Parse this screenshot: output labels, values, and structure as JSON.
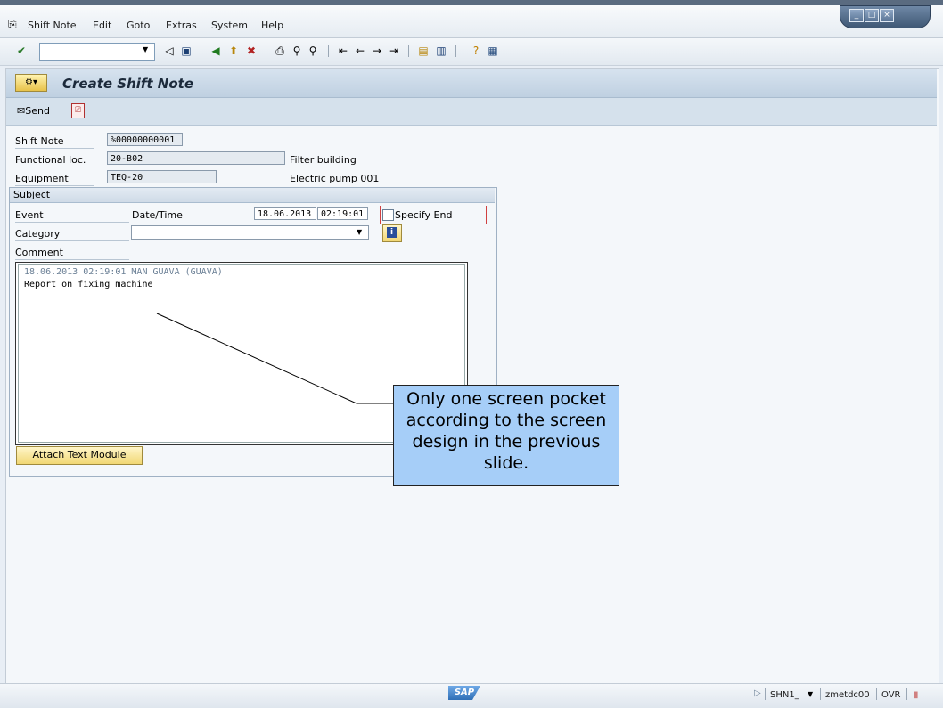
{
  "menu": {
    "items": [
      {
        "label": "Shift Note"
      },
      {
        "label": "Edit"
      },
      {
        "label": "Goto"
      },
      {
        "label": "Extras"
      },
      {
        "label": "System"
      },
      {
        "label": "Help"
      }
    ]
  },
  "window_controls": {
    "minimize": "_",
    "maximize": "□",
    "close": "×"
  },
  "toolbar": {
    "command_field_value": "",
    "icons": [
      "enter-icon",
      "back-arrow-icon",
      "save-icon",
      "back-icon",
      "exit-icon",
      "cancel-icon",
      "print-icon",
      "find-icon",
      "find-next-icon",
      "first-page-icon",
      "prev-page-icon",
      "next-page-icon",
      "last-page-icon",
      "new-session-icon",
      "shortcut-icon",
      "help-icon",
      "layout-icon"
    ]
  },
  "title": "Create Shift Note",
  "appbar": {
    "send_label": "Send"
  },
  "form": {
    "shift_note_label": "Shift Note",
    "shift_note_value": "%00000000001",
    "functional_loc_label": "Functional loc.",
    "functional_loc_value": "20-B02",
    "functional_loc_desc": "Filter building",
    "equipment_label": "Equipment",
    "equipment_value": "TEQ-20",
    "equipment_desc": "Electric pump 001"
  },
  "subject": {
    "header": "Subject",
    "event_label": "Event",
    "datetime_label": "Date/Time",
    "date_value": "18.06.2013",
    "time_value": "02:19:01",
    "specify_end_label": "Specify End",
    "category_label": "Category",
    "category_value": "",
    "comment_label": "Comment",
    "comment_header_line": "18.06.2013 02:19:01 MAN GUAVA (GUAVA)",
    "comment_text": "Report on fixing machine",
    "attach_button": "Attach Text Module"
  },
  "callout": {
    "text": "Only one screen pocket according to the screen design in the previous slide."
  },
  "status": {
    "logo": "SAP",
    "system": "SHN1_",
    "server": "zmetdc00",
    "mode": "OVR"
  }
}
